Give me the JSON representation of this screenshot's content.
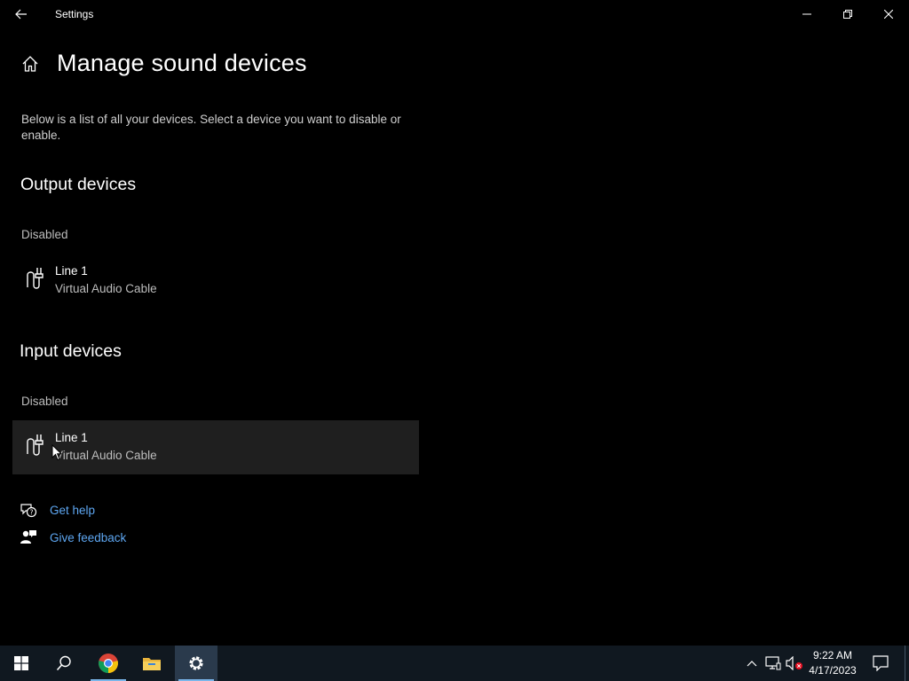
{
  "window": {
    "title": "Settings"
  },
  "page": {
    "title": "Manage sound devices",
    "description": "Below is a list of all your devices. Select a device you want to disable or enable."
  },
  "output": {
    "heading": "Output devices",
    "status": "Disabled",
    "devices": [
      {
        "name": "Line 1",
        "subtitle": "Virtual Audio Cable",
        "icon": "cable-connector-icon"
      }
    ]
  },
  "input": {
    "heading": "Input devices",
    "status": "Disabled",
    "devices": [
      {
        "name": "Line 1",
        "subtitle": "Virtual Audio Cable",
        "icon": "cable-connector-icon"
      }
    ]
  },
  "links": {
    "help": "Get help",
    "feedback": "Give feedback"
  },
  "taskbar": {
    "apps": [
      "start-icon",
      "search-icon",
      "chrome-icon",
      "file-explorer-icon",
      "settings-icon"
    ],
    "active_app": "settings-icon",
    "tray": [
      "chevron-up-icon",
      "network-icon",
      "volume-muted-icon"
    ],
    "time": "9:22 AM",
    "date": "4/17/2023",
    "notification_icon": "action-center-icon"
  },
  "colors": {
    "background": "#000000",
    "link": "#5ea7f2",
    "hover_row": "#1f1f1f",
    "taskbar": "#101820"
  }
}
